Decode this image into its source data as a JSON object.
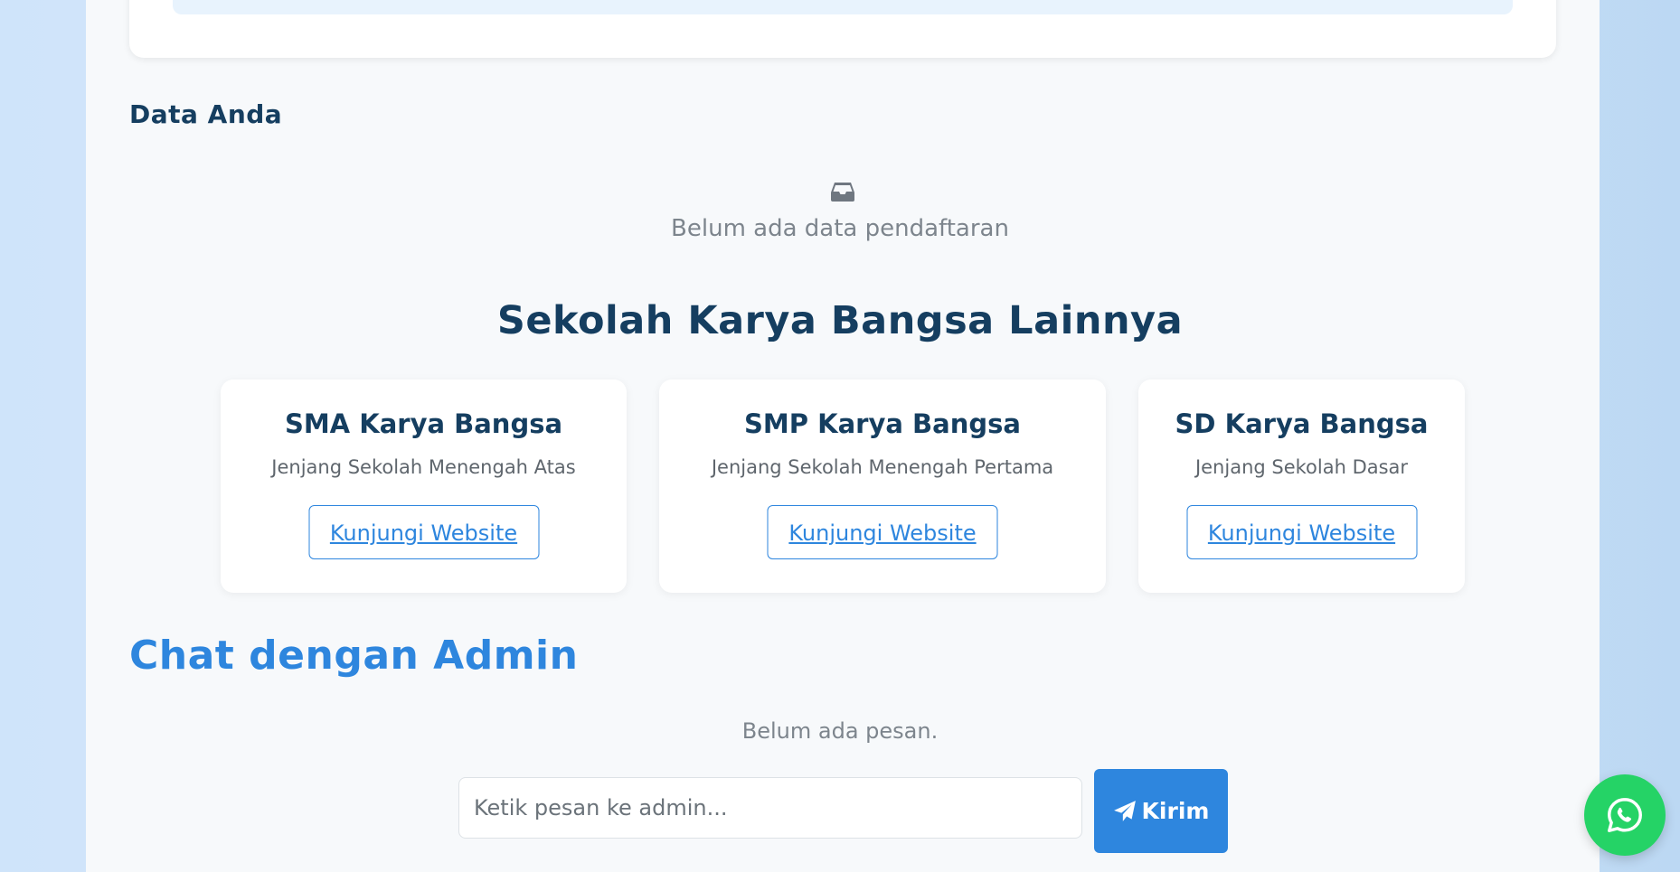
{
  "data_section": {
    "heading": "Data Anda",
    "empty_icon": "inbox-icon",
    "empty_text": "Belum ada data pendaftaran"
  },
  "schools_section": {
    "heading": "Sekolah Karya Bangsa Lainnya",
    "cards": [
      {
        "name": "SMA Karya Bangsa",
        "description": "Jenjang Sekolah Menengah Atas",
        "button_label": "Kunjungi Website"
      },
      {
        "name": "SMP Karya Bangsa",
        "description": "Jenjang Sekolah Menengah Pertama",
        "button_label": "Kunjungi Website"
      },
      {
        "name": "SD Karya Bangsa",
        "description": "Jenjang Sekolah Dasar",
        "button_label": "Kunjungi Website"
      }
    ]
  },
  "chat_section": {
    "heading": "Chat dengan Admin",
    "empty_text": "Belum ada pesan.",
    "input_placeholder": "Ketik pesan ke admin...",
    "send_label": "Kirim",
    "send_icon": "paper-plane-icon"
  },
  "floating": {
    "whatsapp_icon": "whatsapp-icon"
  },
  "colors": {
    "primary": "#2e86de",
    "heading_dark": "#153e60",
    "whatsapp": "#25d366",
    "muted_text": "#7d858d"
  }
}
